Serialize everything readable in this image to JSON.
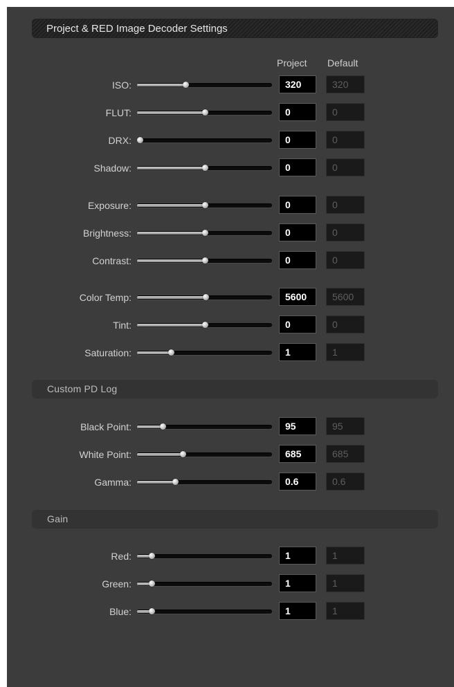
{
  "title": "Project & RED Image Decoder Settings",
  "columns": {
    "project": "Project",
    "default": "Default"
  },
  "decoder": [
    {
      "label": "ISO:",
      "project": "320",
      "default": "320",
      "level": 0.36
    },
    {
      "label": "FLUT:",
      "project": "0",
      "default": "0",
      "level": 0.5
    },
    {
      "label": "DRX:",
      "project": "0",
      "default": "0",
      "level": 0.02
    },
    {
      "label": "Shadow:",
      "project": "0",
      "default": "0",
      "level": 0.5
    },
    {
      "label": "Exposure:",
      "project": "0",
      "default": "0",
      "level": 0.5
    },
    {
      "label": "Brightness:",
      "project": "0",
      "default": "0",
      "level": 0.5
    },
    {
      "label": "Contrast:",
      "project": "0",
      "default": "0",
      "level": 0.5
    },
    {
      "label": "Color Temp:",
      "project": "5600",
      "default": "5600",
      "level": 0.51
    },
    {
      "label": "Tint:",
      "project": "0",
      "default": "0",
      "level": 0.5
    },
    {
      "label": "Saturation:",
      "project": "1",
      "default": "1",
      "level": 0.25
    }
  ],
  "custom_pd_log": {
    "title": "Custom PD Log",
    "rows": [
      {
        "label": "Black Point:",
        "project": "95",
        "default": "95",
        "level": 0.19
      },
      {
        "label": "White Point:",
        "project": "685",
        "default": "685",
        "level": 0.34
      },
      {
        "label": "Gamma:",
        "project": "0.6",
        "default": "0.6",
        "level": 0.28
      }
    ]
  },
  "gain": {
    "title": "Gain",
    "rows": [
      {
        "label": "Red:",
        "project": "1",
        "default": "1",
        "level": 0.11
      },
      {
        "label": "Green:",
        "project": "1",
        "default": "1",
        "level": 0.11
      },
      {
        "label": "Blue:",
        "project": "1",
        "default": "1",
        "level": 0.11
      }
    ]
  }
}
